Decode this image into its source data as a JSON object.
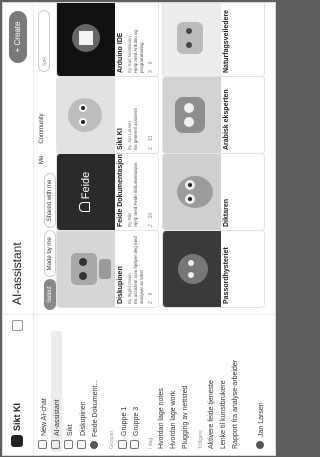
{
  "header": {
    "brand": "Sikt KI",
    "page_title": "AI-assistant",
    "create_label": "+ Create"
  },
  "sidebar": {
    "items": [
      {
        "label": "New AI-chat"
      },
      {
        "label": "AI-assistant"
      },
      {
        "label": "Sikt"
      },
      {
        "label": "Diskupinen"
      },
      {
        "label": "Feide Dokument..."
      }
    ],
    "group_section": "Grupper",
    "groups": [
      {
        "label": "Gruppe 1"
      },
      {
        "label": "Gruppe 3"
      }
    ],
    "chats_section": "I dag",
    "chats": [
      {
        "label": "Hvordan lage notes"
      },
      {
        "label": "Hvordan lage work"
      },
      {
        "label": "Plugging av nettsted"
      }
    ],
    "older_section": "Tidligere",
    "older": [
      {
        "label": "Aktivere feide tjeneste"
      },
      {
        "label": "Lenke til kunstbrukere"
      },
      {
        "label": "Rapport fra analyse-arbeider"
      }
    ],
    "user": "Jan Larsen"
  },
  "main": {
    "tabs": [
      {
        "label": "Select"
      },
      {
        "label": "Made by me"
      },
      {
        "label": "Shared with me"
      }
    ],
    "segments": [
      {
        "label": "Me"
      },
      {
        "label": "Community"
      }
    ],
    "search_placeholder": "Søk"
  },
  "cards": [
    {
      "title": "Diskupinen",
      "sub": "By Ingrid Olsen",
      "desc": "En assistent som hjelper deg med analyser av tekst",
      "likes": "2",
      "views": "8"
    },
    {
      "title": "Feide Dokumentasjon",
      "sub": "By Sikt",
      "desc": "Hjelp med Feide dokumentasjon",
      "likes": "2",
      "views": "20"
    },
    {
      "title": "Sikt KI",
      "sub": "By Jan Larsen",
      "desc": "En generell assistent",
      "likes": "2",
      "views": "13"
    },
    {
      "title": "Arduino IDE",
      "sub": "By Kari Nordmann",
      "desc": "Hjelp med Arduino og programmering",
      "likes": "3",
      "views": "9"
    },
    {
      "title": "Passordhysteriet",
      "sub": "",
      "desc": "",
      "likes": "",
      "views": ""
    },
    {
      "title": "Diktaren",
      "sub": "",
      "desc": "",
      "likes": "",
      "views": ""
    },
    {
      "title": "Arabisk eksperten",
      "sub": "",
      "desc": "",
      "likes": "",
      "views": ""
    },
    {
      "title": "Naturfagsveiledere",
      "sub": "",
      "desc": "",
      "likes": "",
      "views": ""
    }
  ],
  "brand_text": "Feide"
}
